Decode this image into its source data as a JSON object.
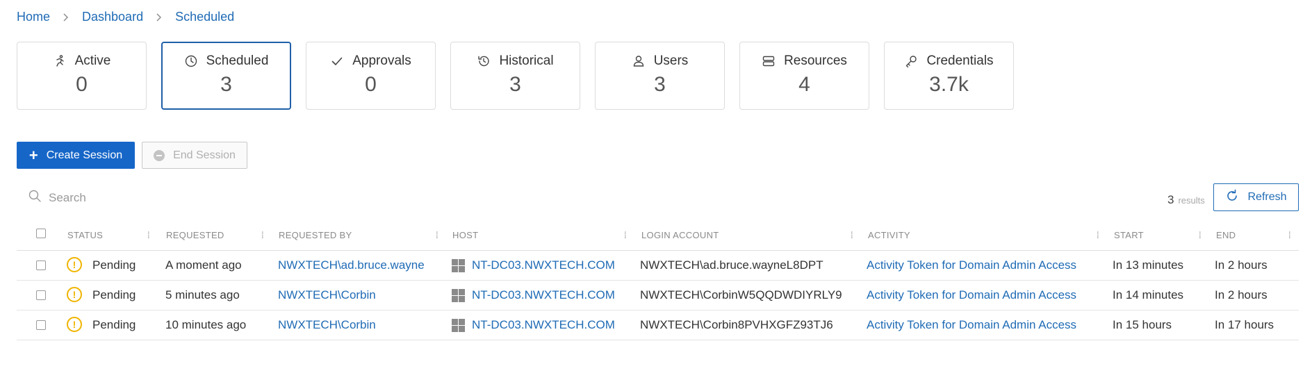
{
  "breadcrumb": {
    "items": [
      "Home",
      "Dashboard",
      "Scheduled"
    ]
  },
  "cards": [
    {
      "label": "Active",
      "value": "0",
      "icon": "running-person-icon",
      "selected": false
    },
    {
      "label": "Scheduled",
      "value": "3",
      "icon": "clock-icon",
      "selected": true
    },
    {
      "label": "Approvals",
      "value": "0",
      "icon": "check-icon",
      "selected": false
    },
    {
      "label": "Historical",
      "value": "3",
      "icon": "history-icon",
      "selected": false
    },
    {
      "label": "Users",
      "value": "3",
      "icon": "user-icon",
      "selected": false
    },
    {
      "label": "Resources",
      "value": "4",
      "icon": "server-icon",
      "selected": false
    },
    {
      "label": "Credentials",
      "value": "3.7k",
      "icon": "key-icon",
      "selected": false
    }
  ],
  "toolbar": {
    "create_label": "Create Session",
    "end_label": "End Session"
  },
  "search": {
    "placeholder": "Search",
    "value": ""
  },
  "results": {
    "count": "3",
    "label": "results"
  },
  "refresh_label": "Refresh",
  "table": {
    "columns": [
      "STATUS",
      "REQUESTED",
      "REQUESTED BY",
      "HOST",
      "LOGIN ACCOUNT",
      "ACTIVITY",
      "START",
      "END"
    ],
    "rows": [
      {
        "status": "Pending",
        "requested": "A moment ago",
        "requested_by": "NWXTECH\\ad.bruce.wayne",
        "host": "NT-DC03.NWXTECH.COM",
        "login_account": "NWXTECH\\ad.bruce.wayneL8DPT",
        "activity": "Activity Token for Domain Admin Access",
        "start": "In 13 minutes",
        "end": "In 2 hours"
      },
      {
        "status": "Pending",
        "requested": "5 minutes ago",
        "requested_by": "NWXTECH\\Corbin",
        "host": "NT-DC03.NWXTECH.COM",
        "login_account": "NWXTECH\\CorbinW5QQDWDIYRLY9",
        "activity": "Activity Token for Domain Admin Access",
        "start": "In 14 minutes",
        "end": "In 2 hours"
      },
      {
        "status": "Pending",
        "requested": "10 minutes ago",
        "requested_by": "NWXTECH\\Corbin",
        "host": "NT-DC03.NWXTECH.COM",
        "login_account": "NWXTECH\\Corbin8PVHXGFZ93TJ6",
        "activity": "Activity Token for Domain Admin Access",
        "start": "In 15 hours",
        "end": "In 17 hours"
      }
    ]
  },
  "colors": {
    "link": "#1f6bb5",
    "primary": "#1666c8",
    "selected_border": "#1f5fa8",
    "pending": "#f0b400"
  }
}
